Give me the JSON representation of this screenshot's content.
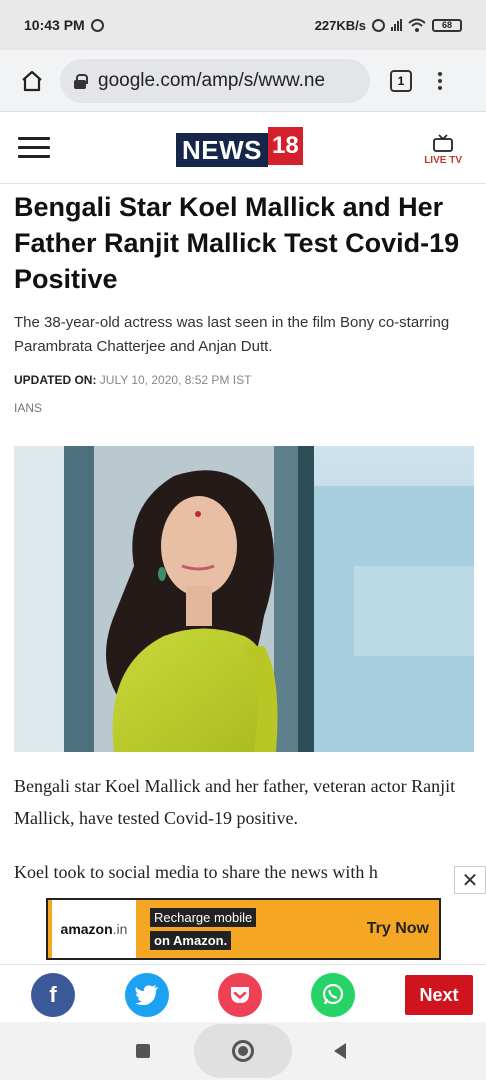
{
  "status_bar": {
    "time": "10:43 PM",
    "speed": "227KB/s",
    "battery": "68"
  },
  "browser": {
    "url": "google.com/amp/s/www.ne",
    "tab_count": "1"
  },
  "site": {
    "logo_text": "NEWS",
    "logo_number": "18",
    "live_tv_label": "LIVE TV",
    "brand_color": "#d4202a"
  },
  "article": {
    "headline": "Bengali Star Koel Mallick and Her Father Ranjit Mallick Test Covid-19 Positive",
    "summary": "The 38-year-old actress was last seen in the film Bony co-starring Parambrata Chatterjee and Anjan Dutt.",
    "updated_label": "UPDATED ON:",
    "updated_value": "JULY 10, 2020, 8:52 PM IST",
    "byline": "IANS",
    "paragraph_1": "Bengali star Koel Mallick and her father, veteran actor Ranjit Mallick, have tested Covid-19 positive.",
    "paragraph_2": "Koel took to social media to share the news with h"
  },
  "ad": {
    "brand": "amazon",
    "brand_suffix": ".in",
    "line_1": "Recharge mobile",
    "line_2": "on Amazon.",
    "cta": "Try Now"
  },
  "share": {
    "facebook": "f",
    "next_label": "Next"
  },
  "icons": {
    "home": "home-icon",
    "lock": "lock-icon",
    "menu": "hamburger-icon",
    "tv": "tv-icon",
    "close": "close-icon",
    "facebook": "facebook-icon",
    "twitter": "twitter-icon",
    "pocket": "pocket-icon",
    "whatsapp": "whatsapp-icon"
  }
}
